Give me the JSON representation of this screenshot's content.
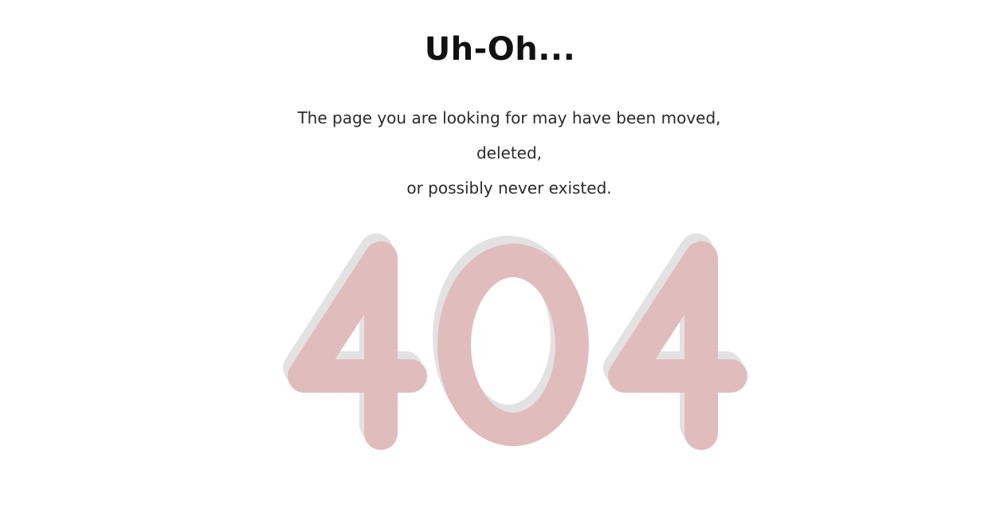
{
  "error_page": {
    "title": "Uh-Oh...",
    "message_line_1": "The page you are looking for may have been moved, deleted,",
    "message_line_2": "or possibly never existed.",
    "error_code": "404"
  },
  "colors": {
    "background": "#ffffff",
    "title": "#111111",
    "message": "#2a2a2a",
    "code_fill": "#e1bcbc",
    "code_shadow": "#e2e2e2"
  }
}
